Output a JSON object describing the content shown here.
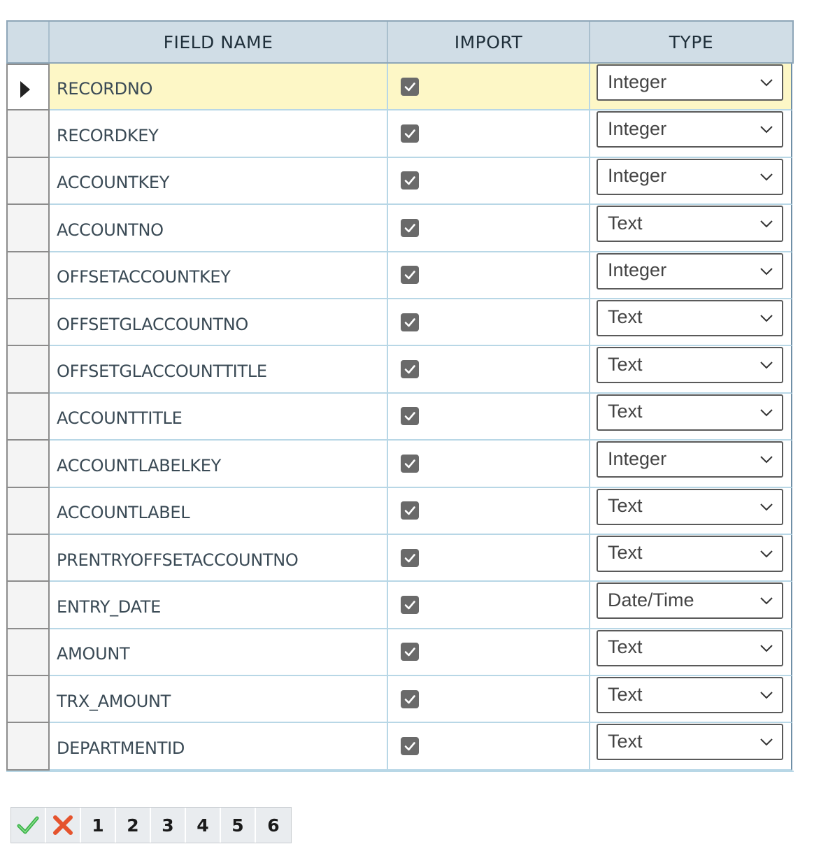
{
  "grid": {
    "headers": {
      "field_name": "FIELD NAME",
      "import": "IMPORT",
      "type": "TYPE"
    },
    "selected_row": 0,
    "rows": [
      {
        "field": "RECORDNO",
        "import": true,
        "type": "Integer"
      },
      {
        "field": "RECORDKEY",
        "import": true,
        "type": "Integer"
      },
      {
        "field": "ACCOUNTKEY",
        "import": true,
        "type": "Integer"
      },
      {
        "field": "ACCOUNTNO",
        "import": true,
        "type": "Text"
      },
      {
        "field": "OFFSETACCOUNTKEY",
        "import": true,
        "type": "Integer"
      },
      {
        "field": "OFFSETGLACCOUNTNO",
        "import": true,
        "type": "Text"
      },
      {
        "field": "OFFSETGLACCOUNTTITLE",
        "import": true,
        "type": "Text"
      },
      {
        "field": "ACCOUNTTITLE",
        "import": true,
        "type": "Text"
      },
      {
        "field": "ACCOUNTLABELKEY",
        "import": true,
        "type": "Integer"
      },
      {
        "field": "ACCOUNTLABEL",
        "import": true,
        "type": "Text"
      },
      {
        "field": "PRENTRYOFFSETACCOUNTNO",
        "import": true,
        "type": "Text"
      },
      {
        "field": "ENTRY_DATE",
        "import": true,
        "type": "Date/Time"
      },
      {
        "field": "AMOUNT",
        "import": true,
        "type": "Text"
      },
      {
        "field": "TRX_AMOUNT",
        "import": true,
        "type": "Text"
      },
      {
        "field": "DEPARTMENTID",
        "import": true,
        "type": "Text"
      }
    ]
  },
  "pager": {
    "confirm_icon": "check-icon",
    "cancel_icon": "cross-icon",
    "pages": [
      "1",
      "2",
      "3",
      "4",
      "5",
      "6"
    ]
  },
  "colors": {
    "header_bg": "#d0dde6",
    "selected_row_bg": "#fdf7c6",
    "checkbox": "#6a6a6a",
    "confirm": "#3bb34a",
    "cancel": "#e5532d"
  }
}
